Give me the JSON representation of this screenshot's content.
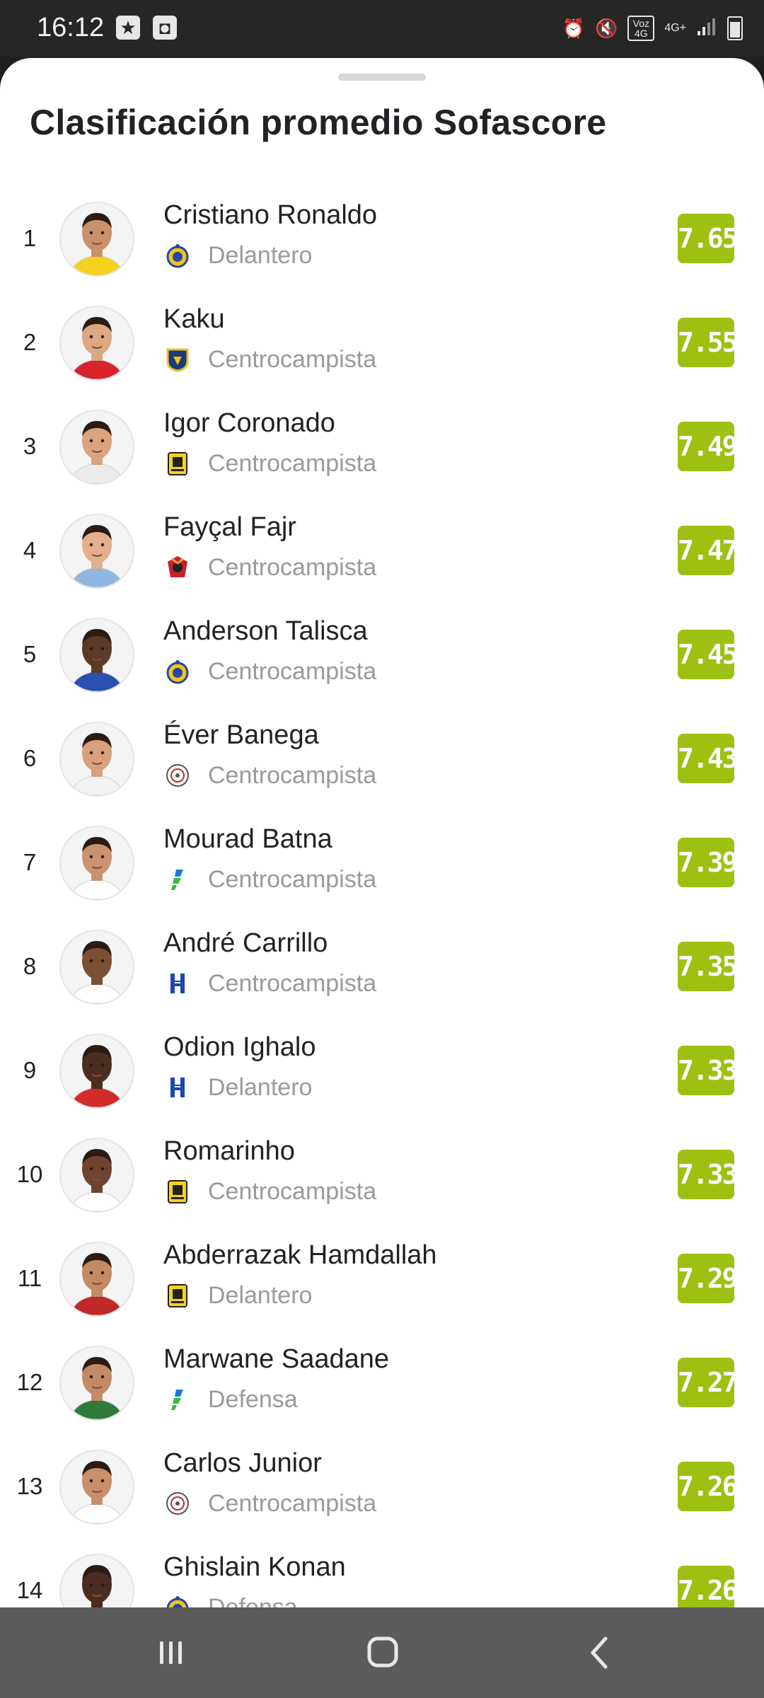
{
  "status_bar": {
    "time": "16:12",
    "left_icons": [
      "star-notification-icon",
      "screen-record-icon"
    ],
    "right_icons": [
      "alarm-icon",
      "mute-icon",
      "volte-icon",
      "4g-plus-icon",
      "signal-icon",
      "battery-icon"
    ],
    "volte_label": "Voz 4G",
    "network_label": "4G+"
  },
  "sheet": {
    "title": "Clasificación promedio Sofascore"
  },
  "colors": {
    "rating_bg": "#9ec011",
    "position_text": "#9a9a9a"
  },
  "players": [
    {
      "rank": "1",
      "name": "Cristiano Ronaldo",
      "position": "Delantero",
      "rating": "7.65",
      "team_icon": "al-nassr-crest-icon",
      "skin": "#c9916b",
      "shirt": "#f4d21e"
    },
    {
      "rank": "2",
      "name": "Kaku",
      "position": "Centrocampista",
      "rating": "7.55",
      "team_icon": "al-taawoun-crest-icon",
      "skin": "#dba882",
      "shirt": "#d8232a"
    },
    {
      "rank": "3",
      "name": "Igor Coronado",
      "position": "Centrocampista",
      "rating": "7.49",
      "team_icon": "al-ittihad-crest-icon",
      "skin": "#d9a37e",
      "shirt": "#ececec"
    },
    {
      "rank": "4",
      "name": "Fayçal Fajr",
      "position": "Centrocampista",
      "rating": "7.47",
      "team_icon": "al-raed-crest-icon",
      "skin": "#e2b08c",
      "shirt": "#8fb7e0"
    },
    {
      "rank": "5",
      "name": "Anderson Talisca",
      "position": "Centrocampista",
      "rating": "7.45",
      "team_icon": "al-nassr-crest-icon",
      "skin": "#5b3a26",
      "shirt": "#2b4fb3"
    },
    {
      "rank": "6",
      "name": "Éver Banega",
      "position": "Centrocampista",
      "rating": "7.43",
      "team_icon": "al-shabab-crest-icon",
      "skin": "#d6a17c",
      "shirt": "#f2f2f2"
    },
    {
      "rank": "7",
      "name": "Mourad Batna",
      "position": "Centrocampista",
      "rating": "7.39",
      "team_icon": "al-fateh-crest-icon",
      "skin": "#c99372",
      "shirt": "#ffffff"
    },
    {
      "rank": "8",
      "name": "André Carrillo",
      "position": "Centrocampista",
      "rating": "7.35",
      "team_icon": "al-hilal-crest-icon",
      "skin": "#7a4f34",
      "shirt": "#ffffff"
    },
    {
      "rank": "9",
      "name": "Odion Ighalo",
      "position": "Delantero",
      "rating": "7.33",
      "team_icon": "al-hilal-crest-icon",
      "skin": "#4a2e20",
      "shirt": "#d32a2a"
    },
    {
      "rank": "10",
      "name": "Romarinho",
      "position": "Centrocampista",
      "rating": "7.33",
      "team_icon": "al-ittihad-crest-icon",
      "skin": "#6e4430",
      "shirt": "#ffffff"
    },
    {
      "rank": "11",
      "name": "Abderrazak Hamdallah",
      "position": "Delantero",
      "rating": "7.29",
      "team_icon": "al-ittihad-crest-icon",
      "skin": "#c48a64",
      "shirt": "#c0282a"
    },
    {
      "rank": "12",
      "name": "Marwane Saadane",
      "position": "Defensa",
      "rating": "7.27",
      "team_icon": "al-fateh-crest-icon",
      "skin": "#c28b68",
      "shirt": "#2f7a3a"
    },
    {
      "rank": "13",
      "name": "Carlos Junior",
      "position": "Centrocampista",
      "rating": "7.26",
      "team_icon": "al-shabab-crest-icon",
      "skin": "#c98f6a",
      "shirt": "#ffffff"
    },
    {
      "rank": "14",
      "name": "Ghislain Konan",
      "position": "Defensa",
      "rating": "7.26",
      "team_icon": "al-nassr-crest-icon",
      "skin": "#4a2d1e",
      "shirt": "#f4d21e"
    }
  ],
  "nav_bar": {
    "buttons": [
      "recent-apps-icon",
      "home-icon",
      "back-icon"
    ]
  }
}
